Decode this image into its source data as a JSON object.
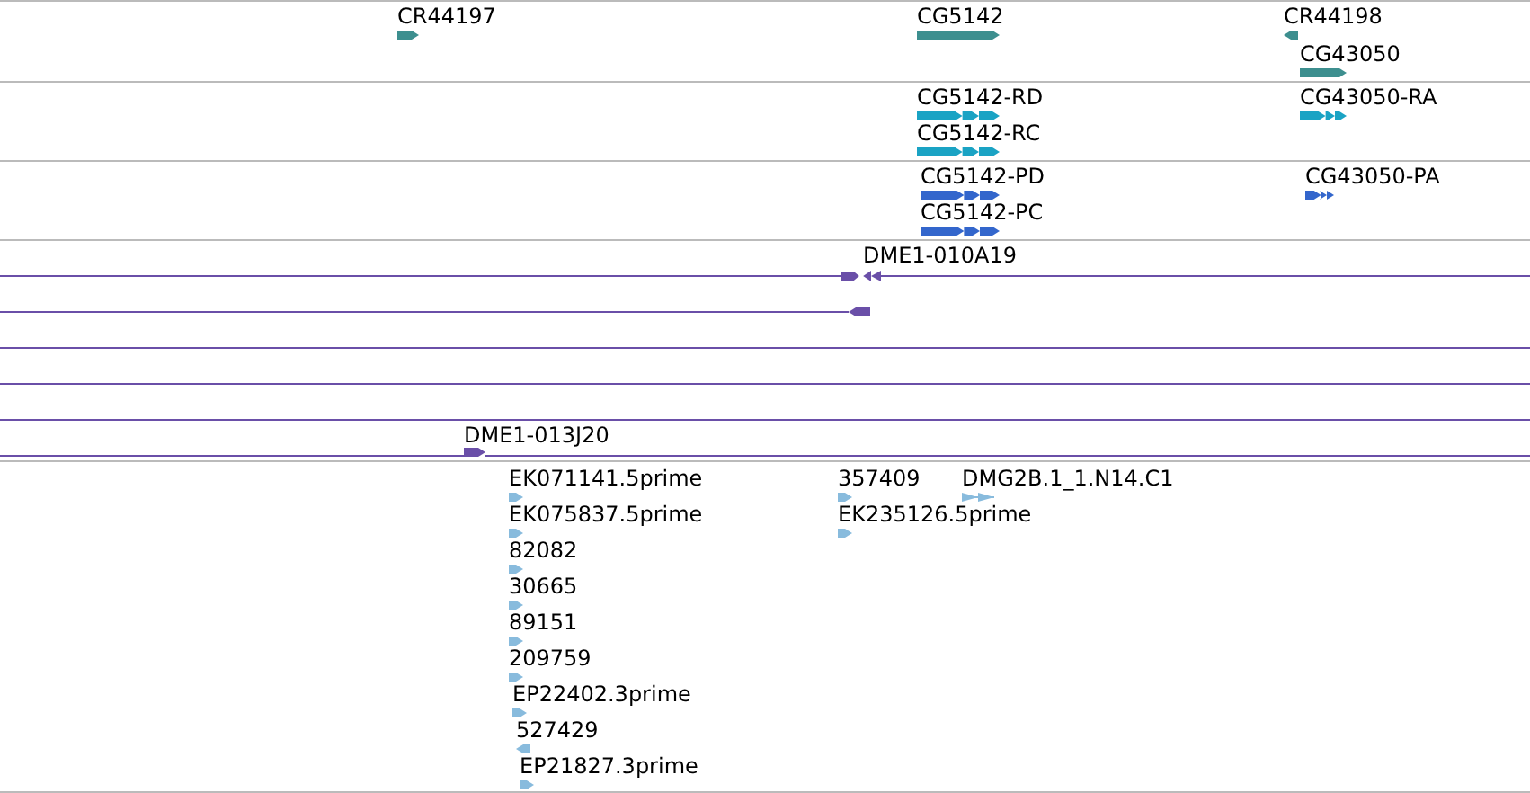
{
  "tracks": [
    {
      "kind": "gene",
      "color": "#3d8f8f",
      "features": [
        {
          "kind": "feature",
          "label": "CR44197",
          "reverse": false
        },
        {
          "kind": "feature",
          "label": "CG5142",
          "reverse": false
        },
        {
          "kind": "feature",
          "label": "CR44198",
          "reverse": true
        },
        {
          "kind": "feature",
          "label": "CG43050",
          "reverse": false
        }
      ]
    },
    {
      "kind": "transcript",
      "color": "#1aa3c4",
      "features": [
        {
          "kind": "feature",
          "label": "CG5142-RD",
          "reverse": false
        },
        {
          "kind": "feature",
          "label": "CG5142-RC",
          "reverse": false
        },
        {
          "kind": "feature",
          "label": "CG43050-RA",
          "reverse": false
        }
      ]
    },
    {
      "kind": "protein",
      "color": "#3366cc",
      "features": [
        {
          "kind": "feature",
          "label": "CG5142-PD",
          "reverse": false
        },
        {
          "kind": "feature",
          "label": "CG5142-PC",
          "reverse": false
        },
        {
          "kind": "feature",
          "label": "CG43050-PA",
          "reverse": false
        }
      ]
    },
    {
      "kind": "clone",
      "color": "#6a4fa8",
      "features": [
        {
          "kind": "clone-pair",
          "label": "DME1-010A19"
        },
        {
          "kind": "clone-end",
          "reverse": true
        },
        {
          "kind": "line"
        },
        {
          "kind": "line"
        },
        {
          "kind": "line"
        },
        {
          "kind": "clone",
          "label": "DME1-013J20",
          "reverse": false
        }
      ]
    },
    {
      "kind": "est",
      "color": "#88bbdd",
      "features": [
        {
          "kind": "feature",
          "label": "EK071141.5prime",
          "reverse": false
        },
        {
          "kind": "feature",
          "label": "EK075837.5prime",
          "reverse": false
        },
        {
          "kind": "feature",
          "label": "82082",
          "reverse": false
        },
        {
          "kind": "feature",
          "label": "30665",
          "reverse": false
        },
        {
          "kind": "feature",
          "label": "89151",
          "reverse": false
        },
        {
          "kind": "feature",
          "label": "209759",
          "reverse": false
        },
        {
          "kind": "feature",
          "label": "EP22402.3prime",
          "reverse": false
        },
        {
          "kind": "feature",
          "label": "527429",
          "reverse": true
        },
        {
          "kind": "feature",
          "label": "EP21827.3prime",
          "reverse": false
        },
        {
          "kind": "feature",
          "label": "357409",
          "reverse": false
        },
        {
          "kind": "feature",
          "label": "EK235126.5prime",
          "reverse": false
        },
        {
          "kind": "pair",
          "label": "DMG2B.1_1.N14.C1"
        }
      ]
    }
  ]
}
